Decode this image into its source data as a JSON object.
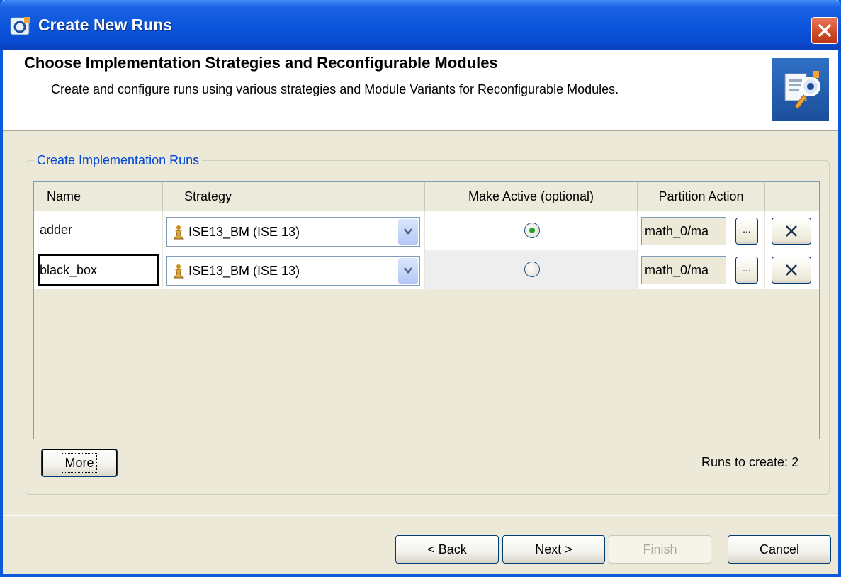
{
  "window": {
    "title": "Create New Runs"
  },
  "header": {
    "title": "Choose Implementation Strategies and Reconfigurable Modules",
    "subtitle": "Create and configure runs using various strategies and Module Variants for Reconfigurable Modules."
  },
  "group": {
    "title": "Create Implementation Runs"
  },
  "table": {
    "columns": [
      "Name",
      "Strategy",
      "Make Active (optional)",
      "Partition Action"
    ],
    "rows": [
      {
        "name": "adder",
        "strategy": "ISE13_BM (ISE 13)",
        "active": true,
        "partition": "math_0/ma",
        "browse": "..."
      },
      {
        "name": "black_box",
        "strategy": "ISE13_BM (ISE 13)",
        "active": false,
        "partition": "math_0/ma",
        "browse": "..."
      }
    ]
  },
  "more_button": "More",
  "runs_to_create": "Runs to create: 2",
  "footer": {
    "back": "< Back",
    "next": "Next >",
    "finish": "Finish",
    "cancel": "Cancel"
  },
  "colors": {
    "titlebar": "#0a55dc",
    "group_title": "#0046d5",
    "radio_selected": "#21a121",
    "close_button": "#d24a22"
  }
}
